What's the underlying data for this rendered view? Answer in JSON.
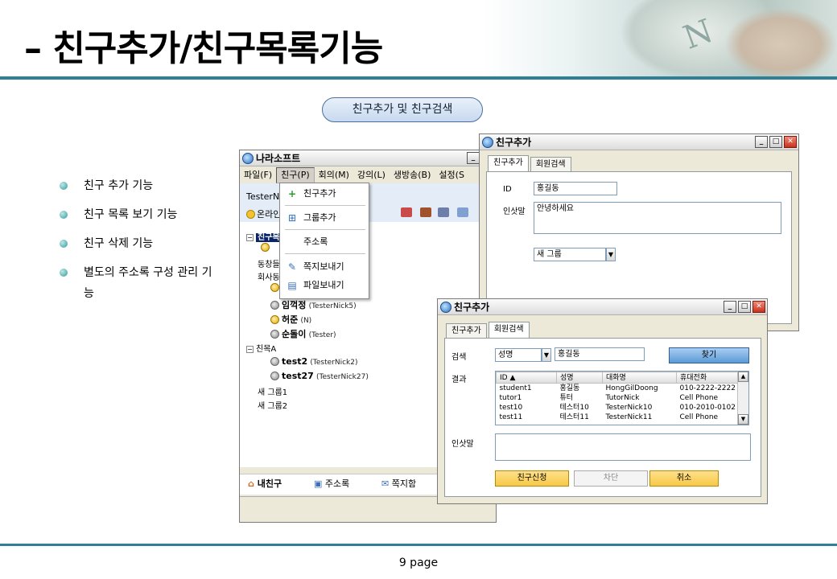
{
  "slide": {
    "title": "– 친구추가/친구목록기능",
    "section_pill": "친구추가 및 친구검색",
    "page_number": "9 page"
  },
  "bullets": [
    "친구 추가 기능",
    "친구 목록 보기 기능",
    "친구 삭제 기능",
    "별도의 주소록 구성 관리 기능"
  ],
  "main_window": {
    "title": "나라소프트",
    "menu": [
      "파일(F)",
      "친구(P)",
      "회의(M)",
      "강의(L)",
      "생방송(B)",
      "설정(S"
    ],
    "username": "TesterNi",
    "status": "온라인",
    "tree": {
      "group_selected": "친구목",
      "group_classmates": "동창들",
      "group_company": "회사동",
      "friends": [
        {
          "name": "임꺽정",
          "nick": "(TesterNick5)",
          "online": false
        },
        {
          "name": "허준",
          "nick": "(N)",
          "online": true
        },
        {
          "name": "순돌이",
          "nick": "(Tester)",
          "online": false
        }
      ],
      "group_a": "친목A",
      "group_a_friends": [
        {
          "name": "test2",
          "nick": "(TesterNick2)"
        },
        {
          "name": "test27",
          "nick": "(TesterNick27)"
        }
      ],
      "new_group_1": "새 그룹1",
      "new_group_2": "새 그룹2"
    },
    "bottom_tabs": [
      "내친구",
      "주소록",
      "쪽지함"
    ]
  },
  "friend_menu": {
    "items": [
      "친구추가",
      "그룹추가",
      "주소록",
      "쪽지보내기",
      "파일보내기"
    ]
  },
  "add_window_1": {
    "title": "친구추가",
    "tabs": [
      "친구추가",
      "회원검색"
    ],
    "id_label": "ID",
    "id_value": "홍길동",
    "greeting_label": "인삿말",
    "greeting_value": "안녕하세요",
    "group_value": "새 그룹"
  },
  "add_window_2": {
    "title": "친구추가",
    "tabs": [
      "친구추가",
      "회원검색"
    ],
    "search_label": "검색",
    "search_field_value": "성명",
    "search_query": "홍길동",
    "find_button": "찾기",
    "result_label": "결과",
    "columns": [
      "ID ▲",
      "성명",
      "대화명",
      "휴대전화"
    ],
    "rows": [
      [
        "student1",
        "홍길동",
        "HongGilDoong",
        "010-2222-2222"
      ],
      [
        "tutor1",
        "튜터",
        "TutorNick",
        "Cell Phone"
      ],
      [
        "test10",
        "테스터10",
        "TesterNick10",
        "010-2010-0102"
      ],
      [
        "test11",
        "테스터11",
        "TesterNick11",
        "Cell Phone"
      ]
    ],
    "greeting_label": "인삿말",
    "request_button": "친구신청",
    "block_button": "차단",
    "cancel_button": "취소"
  },
  "colors": {
    "rule": "#2f7f96",
    "accent_button": "#f7c948",
    "find_button": "#5b9bd5"
  }
}
